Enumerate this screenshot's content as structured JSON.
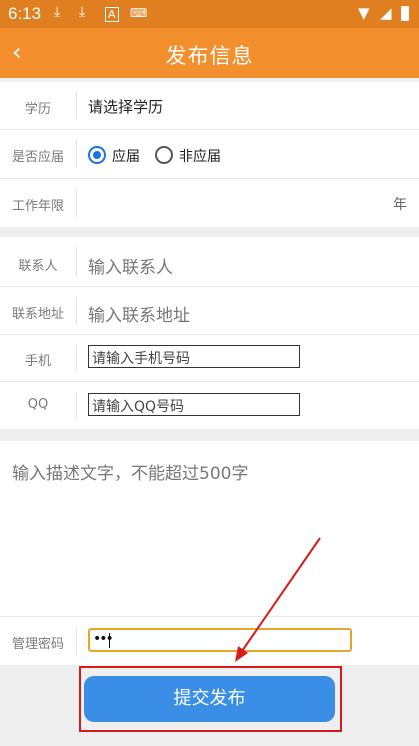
{
  "status_bar": {
    "time": "6:13"
  },
  "header": {
    "back_icon": "chevron-left-icon",
    "title": "发布信息"
  },
  "form": {
    "education": {
      "label": "学历",
      "value": "请选择学历"
    },
    "graduate": {
      "label": "是否应届",
      "option_yes": "应届",
      "option_no": "非应届",
      "selected": "应届"
    },
    "work_years": {
      "label": "工作年限",
      "unit": "年"
    },
    "contact": {
      "label": "联系人",
      "placeholder": "输入联系人"
    },
    "address": {
      "label": "联系地址",
      "placeholder": "输入联系地址"
    },
    "phone": {
      "label": "手机",
      "placeholder": "请输入手机号码"
    },
    "qq": {
      "label": "QQ",
      "placeholder": "请输入QQ号码"
    },
    "description": {
      "placeholder": "输入描述文字，不能超过500字"
    },
    "password": {
      "label": "管理密码",
      "value": "•••"
    }
  },
  "submit_label": "提交发布",
  "colors": {
    "app_bar": "#f38f2c",
    "status_bar": "#e07f1f",
    "button": "#3a8ee6",
    "annotation": "#d51c1c"
  }
}
